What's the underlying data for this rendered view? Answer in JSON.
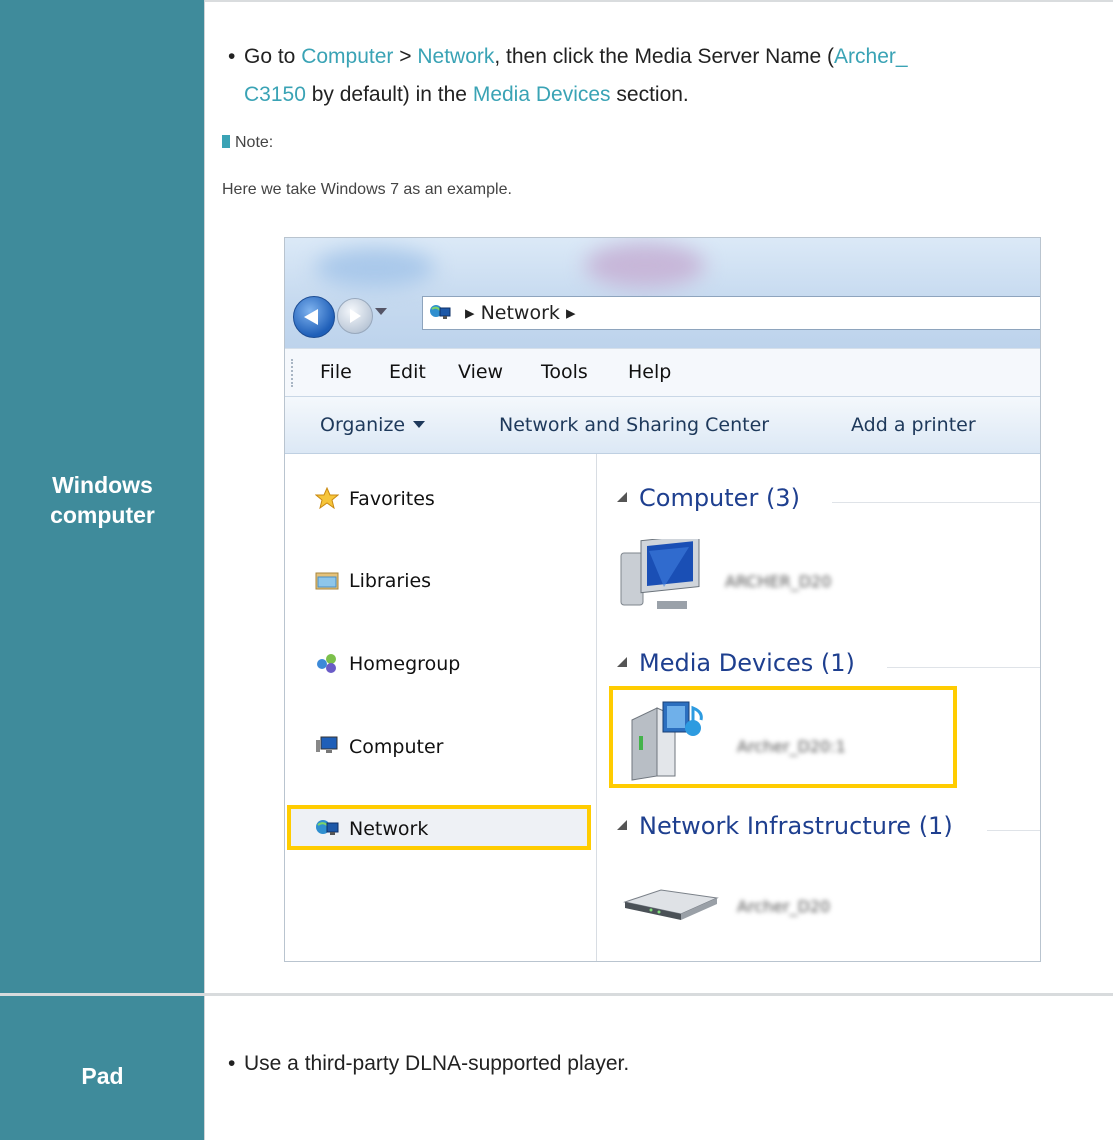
{
  "row1": {
    "label": "Windows computer",
    "label_line1": "Windows",
    "label_line2": "computer",
    "bullet": {
      "p1": "Go to ",
      "computer_link": "Computer",
      "p2": " > ",
      "network_link": "Network",
      "p3": ", then click the Media Server Name (",
      "archer_link_a": "Archer_",
      "archer_link_b": "C3150",
      "p4": " by default) in the ",
      "media_link": "Media Devices",
      "p5": " section."
    },
    "note_label": "Note:",
    "note_body": "Here we take Windows 7 as an example."
  },
  "explorer": {
    "address": "Network",
    "menu": [
      "File",
      "Edit",
      "View",
      "Tools",
      "Help"
    ],
    "commands": {
      "organize": "Organize",
      "sharing": "Network and Sharing Center",
      "printer": "Add a printer"
    },
    "nav": {
      "favorites": "Favorites",
      "libraries": "Libraries",
      "homegroup": "Homegroup",
      "computer": "Computer",
      "network": "Network"
    },
    "groups": {
      "computer": "Computer (3)",
      "media": "Media Devices (1)",
      "infra": "Network Infrastructure (1)"
    },
    "devices": {
      "computer": "ARCHER_D20",
      "media": "Archer_D20:1",
      "infra": "Archer_D20"
    },
    "colors": {
      "highlight": "#ffcc00",
      "group_header": "#1e3f8f"
    }
  },
  "row2": {
    "label": "Pad",
    "bullet": "Use a third-party DLNA-supported player."
  },
  "colors": {
    "label_bg": "#3f8b9b",
    "link": "#3aa3b5"
  }
}
